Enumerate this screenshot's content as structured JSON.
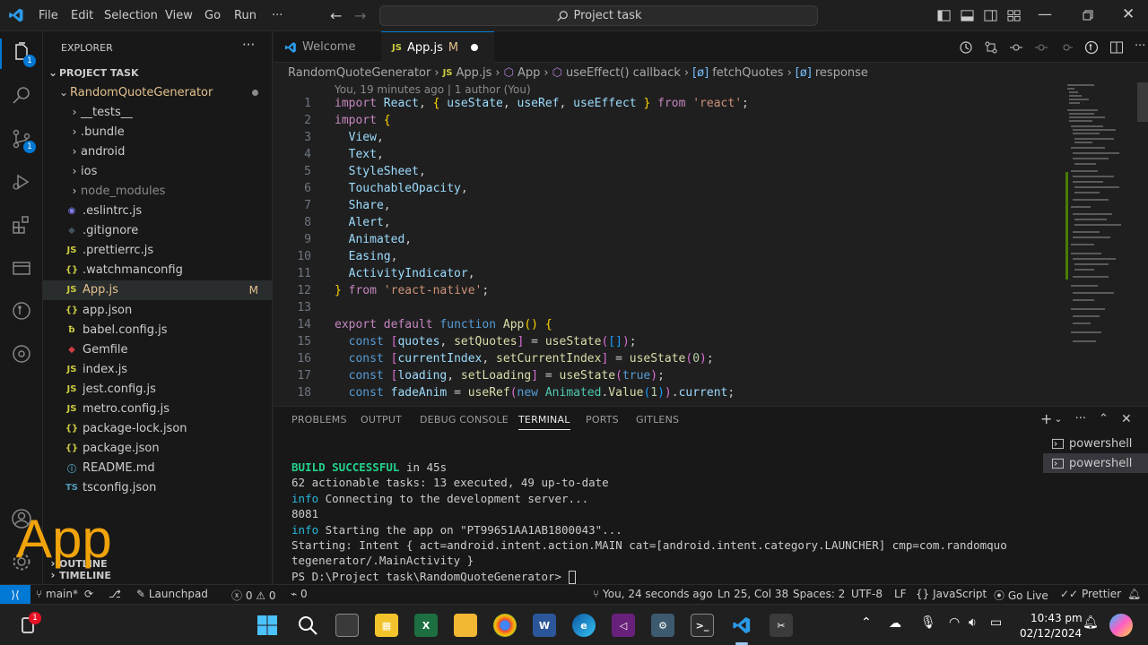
{
  "titlebar": {
    "menu": [
      "File",
      "Edit",
      "Selection",
      "View",
      "Go",
      "Run",
      "···"
    ],
    "search": "Project task"
  },
  "activity": {
    "explorer_badge": "1",
    "scm_badge": "1"
  },
  "sidebar": {
    "header": "EXPLORER",
    "section": "PROJECT TASK",
    "root": "RandomQuoteGenerator",
    "items": [
      {
        "label": "__tests__",
        "kind": "folder"
      },
      {
        "label": ".bundle",
        "kind": "folder"
      },
      {
        "label": "android",
        "kind": "folder"
      },
      {
        "label": "ios",
        "kind": "folder"
      },
      {
        "label": "node_modules",
        "kind": "folder-dim"
      },
      {
        "label": ".eslintrc.js",
        "kind": "eslint"
      },
      {
        "label": ".gitignore",
        "kind": "git"
      },
      {
        "label": ".prettierrc.js",
        "kind": "js"
      },
      {
        "label": ".watchmanconfig",
        "kind": "json"
      },
      {
        "label": "App.js",
        "kind": "js",
        "modified": "M"
      },
      {
        "label": "app.json",
        "kind": "json"
      },
      {
        "label": "babel.config.js",
        "kind": "babel"
      },
      {
        "label": "Gemfile",
        "kind": "ruby"
      },
      {
        "label": "index.js",
        "kind": "js"
      },
      {
        "label": "jest.config.js",
        "kind": "js"
      },
      {
        "label": "metro.config.js",
        "kind": "js"
      },
      {
        "label": "package-lock.json",
        "kind": "json"
      },
      {
        "label": "package.json",
        "kind": "json"
      },
      {
        "label": "README.md",
        "kind": "info"
      },
      {
        "label": "tsconfig.json",
        "kind": "ts"
      }
    ],
    "outline": "OUTLINE",
    "timeline": "TIMELINE",
    "overlay_text": "App"
  },
  "tabs": [
    {
      "label": "Welcome"
    },
    {
      "label": "App.js",
      "badge": "M"
    }
  ],
  "breadcrumb": [
    "RandomQuoteGenerator",
    "App.js",
    "App",
    "useEffect() callback",
    "fetchQuotes",
    "response"
  ],
  "blame": "You, 19 minutes ago | 1 author (You)",
  "code_lines": [
    "1",
    "2",
    "3",
    "4",
    "5",
    "6",
    "7",
    "8",
    "9",
    "10",
    "11",
    "12",
    "13",
    "14",
    "15",
    "16",
    "17",
    "18"
  ],
  "panel": {
    "tabs": [
      "PROBLEMS",
      "OUTPUT",
      "DEBUG CONSOLE",
      "TERMINAL",
      "PORTS",
      "GITLENS"
    ],
    "active_tab": "TERMINAL",
    "terminals": [
      "powershell",
      "powershell"
    ],
    "output": {
      "build_ok": "BUILD SUCCESSFUL",
      "build_time": " in 45s",
      "tasks": "62 actionable tasks: 13 executed, 49 up-to-date",
      "info1_tag": "info",
      "info1": " Connecting to the development server...",
      "port": "8081",
      "info2_tag": "info",
      "info2": " Starting the app on \"PT99651AA1AB1800043\"...",
      "intent1": "Starting: Intent { act=android.intent.action.MAIN cat=[android.intent.category.LAUNCHER] cmp=com.randomquo",
      "intent2": "tegenerator/.MainActivity }",
      "prompt": "PS D:\\Project task\\RandomQuoteGenerator> "
    }
  },
  "statusbar": {
    "branch": "main*",
    "launchpad": "Launchpad",
    "errors": "0",
    "warnings": "0",
    "ports": "0",
    "blame": "You, 24 seconds ago",
    "position": "Ln 25, Col 38",
    "spaces": "Spaces: 2",
    "encoding": "UTF-8",
    "eol": "LF",
    "language": "JavaScript",
    "golive": "Go Live",
    "prettier": "Prettier"
  },
  "taskbar": {
    "time": "10:43 pm",
    "date": "02/12/2024",
    "notif_badge": "1"
  }
}
